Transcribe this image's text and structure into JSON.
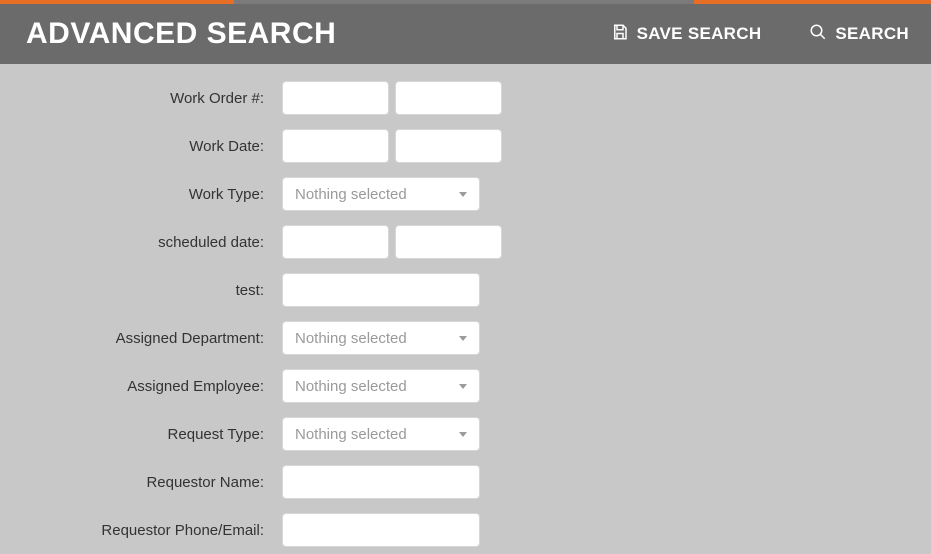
{
  "header": {
    "title": "ADVANCED SEARCH",
    "save_search": "SAVE SEARCH",
    "search": "SEARCH"
  },
  "placeholders": {
    "nothing_selected": "Nothing selected"
  },
  "fields": {
    "work_order_num": {
      "label": "Work Order #:"
    },
    "work_date": {
      "label": "Work Date:"
    },
    "work_type": {
      "label": "Work Type:"
    },
    "scheduled_date": {
      "label": "scheduled date:"
    },
    "test": {
      "label": "test:"
    },
    "assigned_department": {
      "label": "Assigned Department:"
    },
    "assigned_employee": {
      "label": "Assigned Employee:"
    },
    "request_type": {
      "label": "Request Type:"
    },
    "requestor_name": {
      "label": "Requestor Name:"
    },
    "requestor_phone_email": {
      "label": "Requestor Phone/Email:"
    }
  }
}
